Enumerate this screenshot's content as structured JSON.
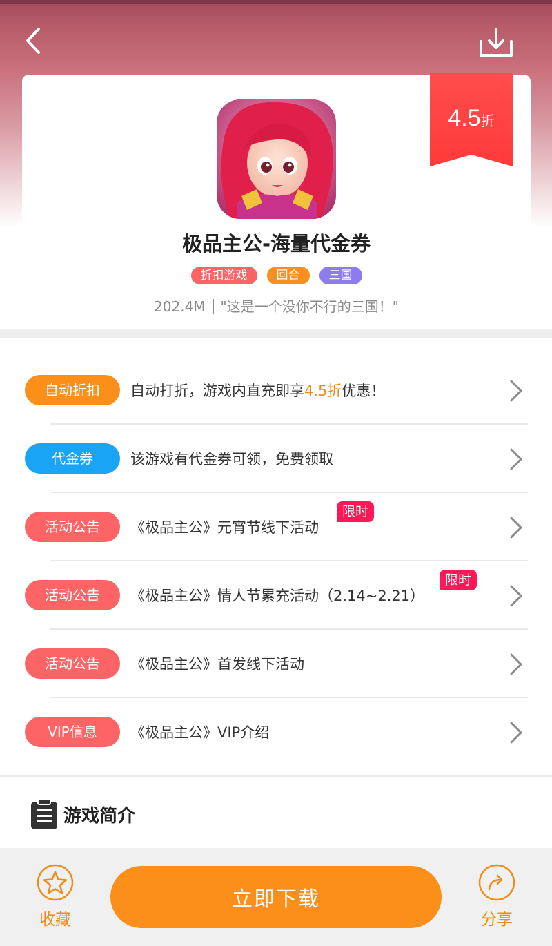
{
  "header": {
    "back_icon": "chevron-left-icon",
    "download_icon": "download-icon"
  },
  "discount": {
    "value": "4.5",
    "unit": "折",
    "color": "#ff3b3b"
  },
  "game": {
    "title": "极品主公-海量代金券",
    "tags": [
      {
        "label": "折扣游戏",
        "color": "#fd6466"
      },
      {
        "label": "回合",
        "color": "#fb8f1a"
      },
      {
        "label": "三国",
        "color": "#8c7cf0"
      }
    ],
    "size": "202.4M",
    "slogan": "\"这是一个没你不行的三国！\""
  },
  "rows": [
    {
      "pill": "自动折扣",
      "pill_color": "#fb8f1a",
      "text_before": "自动打折，游戏内直充即享",
      "text_highlight": "4.5折",
      "text_after": "优惠！"
    },
    {
      "pill": "代金券",
      "pill_color": "#1aa4f5",
      "text": "该游戏有代金券可领，免费领取"
    },
    {
      "pill": "活动公告",
      "pill_color": "#fd6466",
      "text": "《极品主公》元宵节线下活动",
      "badge": "限时"
    },
    {
      "pill": "活动公告",
      "pill_color": "#fd6466",
      "text": "《极品主公》情人节累充活动（2.14~2.21）",
      "badge": "限时"
    },
    {
      "pill": "活动公告",
      "pill_color": "#fd6466",
      "text": "《极品主公》首发线下活动"
    },
    {
      "pill": "VIP信息",
      "pill_color": "#fd6466",
      "text": "《极品主公》VIP介绍"
    }
  ],
  "intro": {
    "title": "游戏简介",
    "icon": "clipboard-icon"
  },
  "bottom_bar": {
    "favorite_label": "收藏",
    "download_label": "立即下载",
    "share_label": "分享",
    "accent": "#f28a18"
  }
}
